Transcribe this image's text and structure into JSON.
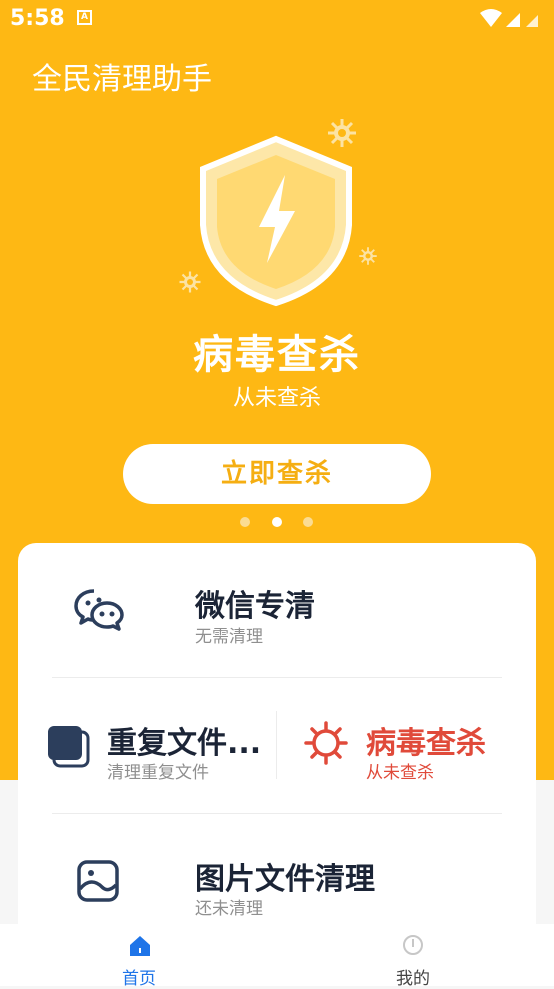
{
  "status_bar": {
    "time": "5:58",
    "notif_icon": "A"
  },
  "app": {
    "title": "全民清理助手"
  },
  "hero": {
    "title": "病毒查杀",
    "subtitle": "从未查杀",
    "button_label": "立即查杀",
    "pager": {
      "count": 3,
      "active_index": 1
    }
  },
  "features": {
    "wechat": {
      "title": "微信专清",
      "subtitle": "无需清理",
      "icon": "wechat-icon"
    },
    "duplicate": {
      "title": "重复文件...",
      "subtitle": "清理重复文件",
      "icon": "duplicate-files-icon"
    },
    "virus": {
      "title": "病毒查杀",
      "subtitle": "从未查杀",
      "icon": "virus-icon"
    },
    "images": {
      "title": "图片文件清理",
      "subtitle": "还未清理",
      "icon": "image-icon"
    }
  },
  "bottom_nav": {
    "home": {
      "label": "首页",
      "icon": "home-icon"
    },
    "mine": {
      "label": "我的",
      "icon": "user-icon"
    }
  },
  "colors": {
    "accent": "#FEB814",
    "danger": "#E04A3A",
    "nav_active": "#1E74E8"
  }
}
